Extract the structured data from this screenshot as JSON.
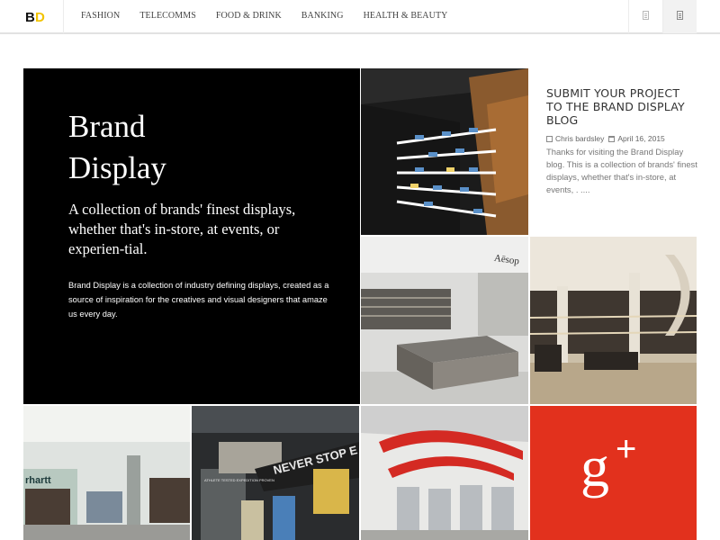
{
  "logo": {
    "first": "B",
    "second": "D"
  },
  "nav": [
    {
      "label": "FASHION"
    },
    {
      "label": "TELECOMMS"
    },
    {
      "label": "FOOD & DRINK"
    },
    {
      "label": "BANKING"
    },
    {
      "label": "HEALTH & BEAUTY"
    }
  ],
  "hero": {
    "title_line1": "Brand",
    "title_line2": "Display",
    "tagline": "A collection of brands' finest displays, whether that's in-store, at events, or experien-tial.",
    "description": "Brand Display is a collection of industry defining displays, created as a source of inspiration for the creatives and visual designers that amaze us every day."
  },
  "post": {
    "title": "SUBMIT YOUR PROJECT TO THE BRAND DISPLAY BLOG",
    "author": "Chris bardsley",
    "date": "April 16, 2015",
    "excerpt": "Thanks for visiting the Brand Display blog. This is a collection of brands' finest displays, whether that's in-store, at events, . ...."
  },
  "tiles": {
    "aesop_sign": "Aēsop",
    "carhartt_sign": "rhartt",
    "never_stop_sign": "NEVER STOP E",
    "athlete_sign": "ATHLETE TESTED EXPEDITION PROVEN"
  },
  "gplus": {
    "g": "g",
    "plus": "+"
  },
  "colors": {
    "accent": "#f2c300",
    "gplus": "#e2311d",
    "hero_bg": "#000000"
  }
}
